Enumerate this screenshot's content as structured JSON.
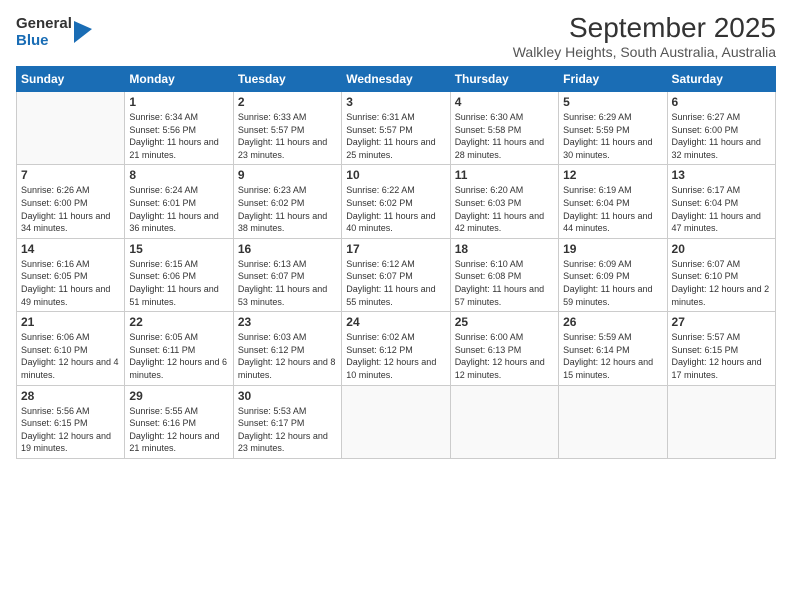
{
  "logo": {
    "general": "General",
    "blue": "Blue"
  },
  "header": {
    "month_title": "September 2025",
    "subtitle": "Walkley Heights, South Australia, Australia"
  },
  "weekdays": [
    "Sunday",
    "Monday",
    "Tuesday",
    "Wednesday",
    "Thursday",
    "Friday",
    "Saturday"
  ],
  "weeks": [
    [
      {
        "day": "",
        "empty": true
      },
      {
        "day": "1",
        "sunrise": "6:34 AM",
        "sunset": "5:56 PM",
        "daylight": "11 hours and 21 minutes."
      },
      {
        "day": "2",
        "sunrise": "6:33 AM",
        "sunset": "5:57 PM",
        "daylight": "11 hours and 23 minutes."
      },
      {
        "day": "3",
        "sunrise": "6:31 AM",
        "sunset": "5:57 PM",
        "daylight": "11 hours and 25 minutes."
      },
      {
        "day": "4",
        "sunrise": "6:30 AM",
        "sunset": "5:58 PM",
        "daylight": "11 hours and 28 minutes."
      },
      {
        "day": "5",
        "sunrise": "6:29 AM",
        "sunset": "5:59 PM",
        "daylight": "11 hours and 30 minutes."
      },
      {
        "day": "6",
        "sunrise": "6:27 AM",
        "sunset": "6:00 PM",
        "daylight": "11 hours and 32 minutes."
      }
    ],
    [
      {
        "day": "7",
        "sunrise": "6:26 AM",
        "sunset": "6:00 PM",
        "daylight": "11 hours and 34 minutes."
      },
      {
        "day": "8",
        "sunrise": "6:24 AM",
        "sunset": "6:01 PM",
        "daylight": "11 hours and 36 minutes."
      },
      {
        "day": "9",
        "sunrise": "6:23 AM",
        "sunset": "6:02 PM",
        "daylight": "11 hours and 38 minutes."
      },
      {
        "day": "10",
        "sunrise": "6:22 AM",
        "sunset": "6:02 PM",
        "daylight": "11 hours and 40 minutes."
      },
      {
        "day": "11",
        "sunrise": "6:20 AM",
        "sunset": "6:03 PM",
        "daylight": "11 hours and 42 minutes."
      },
      {
        "day": "12",
        "sunrise": "6:19 AM",
        "sunset": "6:04 PM",
        "daylight": "11 hours and 44 minutes."
      },
      {
        "day": "13",
        "sunrise": "6:17 AM",
        "sunset": "6:04 PM",
        "daylight": "11 hours and 47 minutes."
      }
    ],
    [
      {
        "day": "14",
        "sunrise": "6:16 AM",
        "sunset": "6:05 PM",
        "daylight": "11 hours and 49 minutes."
      },
      {
        "day": "15",
        "sunrise": "6:15 AM",
        "sunset": "6:06 PM",
        "daylight": "11 hours and 51 minutes."
      },
      {
        "day": "16",
        "sunrise": "6:13 AM",
        "sunset": "6:07 PM",
        "daylight": "11 hours and 53 minutes."
      },
      {
        "day": "17",
        "sunrise": "6:12 AM",
        "sunset": "6:07 PM",
        "daylight": "11 hours and 55 minutes."
      },
      {
        "day": "18",
        "sunrise": "6:10 AM",
        "sunset": "6:08 PM",
        "daylight": "11 hours and 57 minutes."
      },
      {
        "day": "19",
        "sunrise": "6:09 AM",
        "sunset": "6:09 PM",
        "daylight": "11 hours and 59 minutes."
      },
      {
        "day": "20",
        "sunrise": "6:07 AM",
        "sunset": "6:10 PM",
        "daylight": "12 hours and 2 minutes."
      }
    ],
    [
      {
        "day": "21",
        "sunrise": "6:06 AM",
        "sunset": "6:10 PM",
        "daylight": "12 hours and 4 minutes."
      },
      {
        "day": "22",
        "sunrise": "6:05 AM",
        "sunset": "6:11 PM",
        "daylight": "12 hours and 6 minutes."
      },
      {
        "day": "23",
        "sunrise": "6:03 AM",
        "sunset": "6:12 PM",
        "daylight": "12 hours and 8 minutes."
      },
      {
        "day": "24",
        "sunrise": "6:02 AM",
        "sunset": "6:12 PM",
        "daylight": "12 hours and 10 minutes."
      },
      {
        "day": "25",
        "sunrise": "6:00 AM",
        "sunset": "6:13 PM",
        "daylight": "12 hours and 12 minutes."
      },
      {
        "day": "26",
        "sunrise": "5:59 AM",
        "sunset": "6:14 PM",
        "daylight": "12 hours and 15 minutes."
      },
      {
        "day": "27",
        "sunrise": "5:57 AM",
        "sunset": "6:15 PM",
        "daylight": "12 hours and 17 minutes."
      }
    ],
    [
      {
        "day": "28",
        "sunrise": "5:56 AM",
        "sunset": "6:15 PM",
        "daylight": "12 hours and 19 minutes."
      },
      {
        "day": "29",
        "sunrise": "5:55 AM",
        "sunset": "6:16 PM",
        "daylight": "12 hours and 21 minutes."
      },
      {
        "day": "30",
        "sunrise": "5:53 AM",
        "sunset": "6:17 PM",
        "daylight": "12 hours and 23 minutes."
      },
      {
        "day": "",
        "empty": true
      },
      {
        "day": "",
        "empty": true
      },
      {
        "day": "",
        "empty": true
      },
      {
        "day": "",
        "empty": true
      }
    ]
  ]
}
